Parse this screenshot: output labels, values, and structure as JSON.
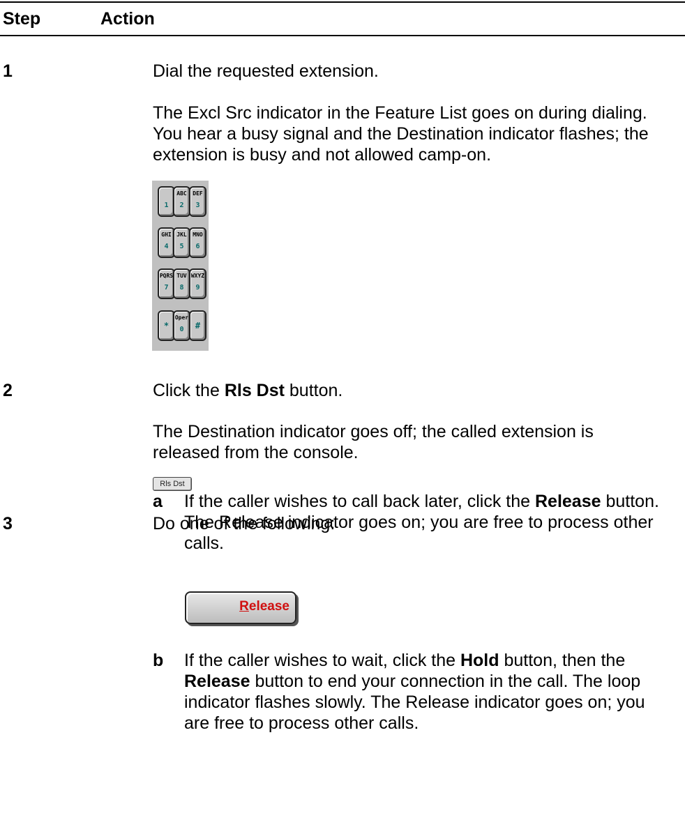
{
  "table": {
    "header_step": "Step",
    "header_action": "Action"
  },
  "steps": [
    {
      "number": "1",
      "line1": "Dial the requested extension.",
      "para": [
        "The Excl Src indicator in the Feature List goes on during dialing.",
        "You hear a busy signal and the Destination indicator flashes; the",
        "extension is busy and not allowed camp-on."
      ]
    },
    {
      "number": "2",
      "line1_pre": "Click the ",
      "line1_bold": "Rls Dst",
      "line1_post": " button.",
      "para": [
        "The Destination indicator goes off; the called extension is",
        "released from the console."
      ],
      "button_label": "Rls Dst"
    },
    {
      "number": "3",
      "line1": "Do one of the following:",
      "options": [
        {
          "letter": "a",
          "l1_pre": "If the caller wishes to call back later, click the ",
          "l1_bold": "Release",
          "l1_post": " button.",
          "l2": "The Release indicator goes on; you are free to process other",
          "l3": "calls.",
          "button_label_first": "R",
          "button_label_rest": "elease"
        },
        {
          "letter": "b",
          "l1_pre": "If the caller wishes to wait, click the ",
          "l1_bold": "Hold",
          "l1_post": " button, then the",
          "l2_bold": "Release",
          "l2_post": " button to end your connection in the call. The loop",
          "l3": "indicator flashes slowly. The Release indicator goes on; you",
          "l4": "are free to process other calls."
        }
      ]
    }
  ],
  "keypad": {
    "keys": [
      {
        "letters": "",
        "digit": "1"
      },
      {
        "letters": "ABC",
        "digit": "2"
      },
      {
        "letters": "DEF",
        "digit": "3"
      },
      {
        "letters": "GHI",
        "digit": "4"
      },
      {
        "letters": "JKL",
        "digit": "5"
      },
      {
        "letters": "MNO",
        "digit": "6"
      },
      {
        "letters": "PQRS",
        "digit": "7"
      },
      {
        "letters": "TUV",
        "digit": "8"
      },
      {
        "letters": "WXYZ",
        "digit": "9"
      },
      {
        "letters": "",
        "digit": "*"
      },
      {
        "letters": "Oper",
        "digit": "0"
      },
      {
        "letters": "",
        "digit": "#"
      }
    ]
  }
}
